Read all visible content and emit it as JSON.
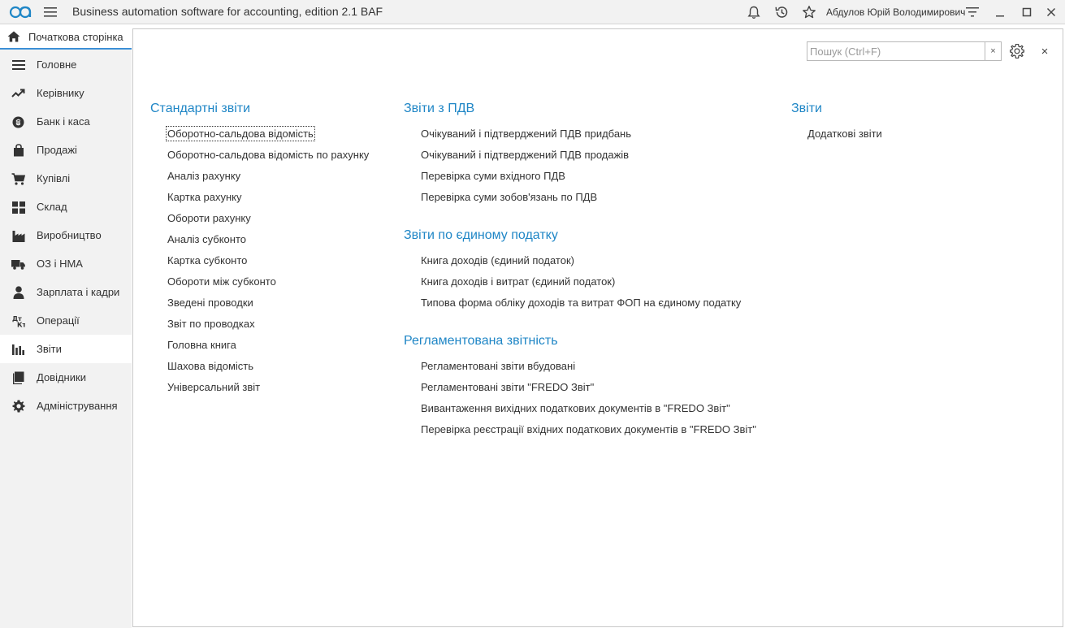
{
  "titlebar": {
    "title": "Business automation software for accounting, edition 2.1 BAF",
    "user": "Абдулов Юрій Володимирович",
    "logo_icon": "logo-icon",
    "menu_icon": "hamburger-icon",
    "icons": [
      "bell-icon",
      "history-icon",
      "star-icon",
      "funnel-icon",
      "minimize-icon",
      "maximize-icon",
      "close-icon"
    ]
  },
  "sidebar": {
    "home": "Початкова сторінка",
    "items": [
      {
        "label": "Головне",
        "icon": "list-icon"
      },
      {
        "label": "Керівнику",
        "icon": "trend-icon"
      },
      {
        "label": "Банк і каса",
        "icon": "coin-icon"
      },
      {
        "label": "Продажі",
        "icon": "bag-icon"
      },
      {
        "label": "Купівлі",
        "icon": "cart-icon"
      },
      {
        "label": "Склад",
        "icon": "grid-icon"
      },
      {
        "label": "Виробництво",
        "icon": "factory-icon"
      },
      {
        "label": "ОЗ і НМА",
        "icon": "truck-icon"
      },
      {
        "label": "Зарплата і кадри",
        "icon": "person-icon"
      },
      {
        "label": "Операції",
        "icon": "operations-icon"
      },
      {
        "label": "Звіти",
        "icon": "bar-chart-icon"
      },
      {
        "label": "Довідники",
        "icon": "book-icon"
      },
      {
        "label": "Адміністрування",
        "icon": "gear-icon"
      }
    ],
    "active_index": 10
  },
  "search": {
    "placeholder": "Пошук (Ctrl+F)",
    "value": "",
    "clear_label": "×"
  },
  "close_label": "×",
  "groups": {
    "standard": {
      "title": "Стандартні звіти",
      "items": [
        "Оборотно-сальдова відомість",
        "Оборотно-сальдова відомість по рахунку",
        "Аналіз рахунку",
        "Картка рахунку",
        "Обороти рахунку",
        "Аналіз субконто",
        "Картка субконто",
        "Обороти між субконто",
        "Зведені проводки",
        "Звіт по проводках",
        "Головна книга",
        "Шахова відомість",
        "Універсальний звіт"
      ]
    },
    "vat": {
      "title": "Звіти з ПДВ",
      "items": [
        "Очікуваний і підтверджений ПДВ придбань",
        "Очікуваний і підтверджений ПДВ продажів",
        "Перевірка суми вхідного ПДВ",
        "Перевірка суми зобов'язань по ПДВ"
      ]
    },
    "single_tax": {
      "title": "Звіти по єдиному податку",
      "items": [
        "Книга доходів (єдиний податок)",
        "Книга доходів і витрат (єдиний податок)",
        "Типова форма обліку доходів та витрат ФОП на єдиному податку"
      ]
    },
    "regulated": {
      "title": "Регламентована звітність",
      "items": [
        "Регламентовані звіти вбудовані",
        "Регламентовані звіти \"FREDO Звіт\"",
        "Вивантаження вихідних податкових документів в \"FREDO Звіт\"",
        "Перевірка реєстрації вхідних податкових документів в \"FREDO Звіт\""
      ]
    },
    "reports": {
      "title": "Звіти",
      "items": [
        "Додаткові звіти"
      ]
    }
  },
  "colors": {
    "accent": "#1f86c6",
    "active_tab": "#3b8fd6",
    "panel_bg": "#f2f2f2"
  }
}
